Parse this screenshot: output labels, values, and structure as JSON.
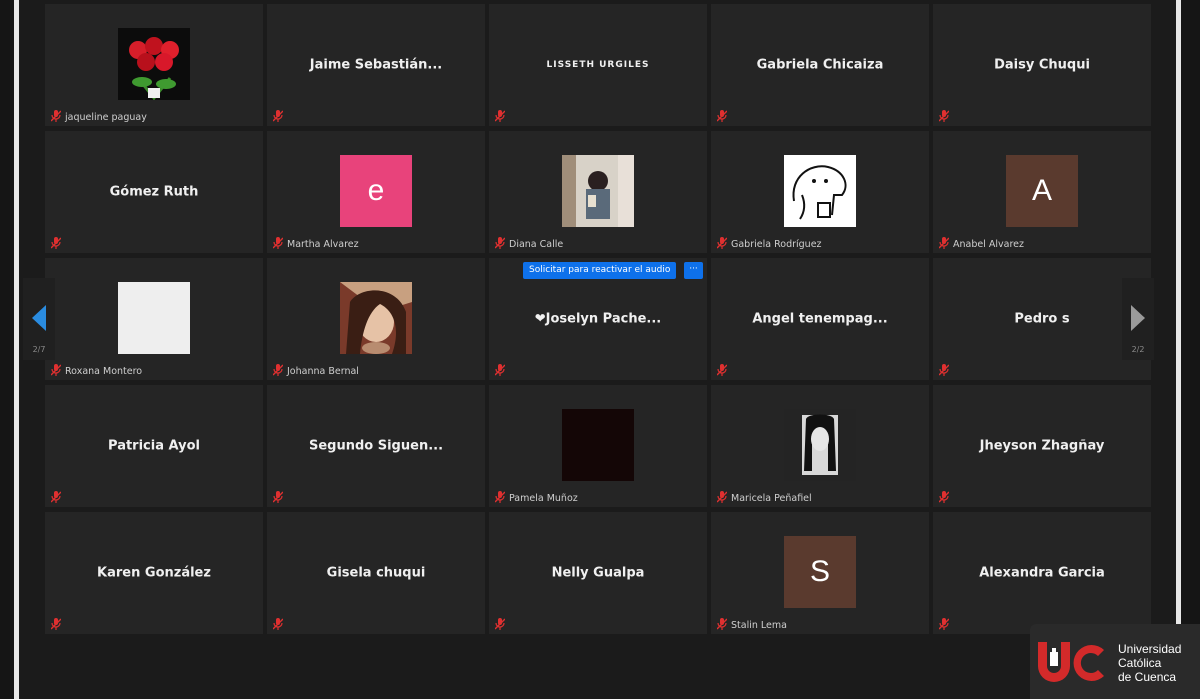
{
  "grid": {
    "rows": [
      [
        {
          "name": "jaqueline paguay",
          "avatar": "roses-photo"
        },
        {
          "name": "Jaime Sebastián..."
        },
        {
          "name": "LISSETH URGILES",
          "smallcaps": true
        },
        {
          "name": "Gabriela Chicaiza"
        },
        {
          "name": "Daisy Chuqui"
        }
      ],
      [
        {
          "name": "Gómez Ruth"
        },
        {
          "name": "Martha Alvarez",
          "avatar": "letter",
          "letter": "e",
          "color": "#e8437b"
        },
        {
          "name": "Diana Calle",
          "avatar": "selfie-photo"
        },
        {
          "name": "Gabriela Rodríguez",
          "avatar": "sketch-drawing"
        },
        {
          "name": "Anabel Alvarez",
          "avatar": "letter",
          "letter": "A",
          "color": "#5a3a2e"
        }
      ],
      [
        {
          "name": "Roxana Montero",
          "avatar": "blank-white"
        },
        {
          "name": "Johanna Bernal",
          "avatar": "portrait-photo"
        },
        {
          "name": "❤Joselyn Pache..."
        },
        {
          "name": "Angel tenempag..."
        },
        {
          "name": "Pedro s"
        }
      ],
      [
        {
          "name": "Patricia Ayol"
        },
        {
          "name": "Segundo Siguen..."
        },
        {
          "name": "Pamela Muñoz",
          "avatar": "dark-square"
        },
        {
          "name": "Maricela Peñafiel",
          "avatar": "bw-portrait"
        },
        {
          "name": "Jheyson Zhagñay"
        }
      ],
      [
        {
          "name": "Karen González"
        },
        {
          "name": "Gisela chuqui"
        },
        {
          "name": "Nelly Gualpa"
        },
        {
          "name": "Stalin Lema",
          "avatar": "letter",
          "letter": "S",
          "color": "#5a3a2e"
        },
        {
          "name": "Alexandra Garcia"
        }
      ]
    ]
  },
  "request_audio": {
    "label": "Solicitar para reactivar el audio",
    "more": "···"
  },
  "nav": {
    "left_page": "2/7",
    "right_page": "2/2"
  },
  "logo": {
    "line1": "Universidad",
    "line2": "Católica",
    "line3": "de Cuenca"
  },
  "colors": {
    "mute_red": "#e03030",
    "zoom_blue": "#0e71eb",
    "tile_bg": "#252525",
    "nav_arrow_blue": "#2a8ce0"
  }
}
